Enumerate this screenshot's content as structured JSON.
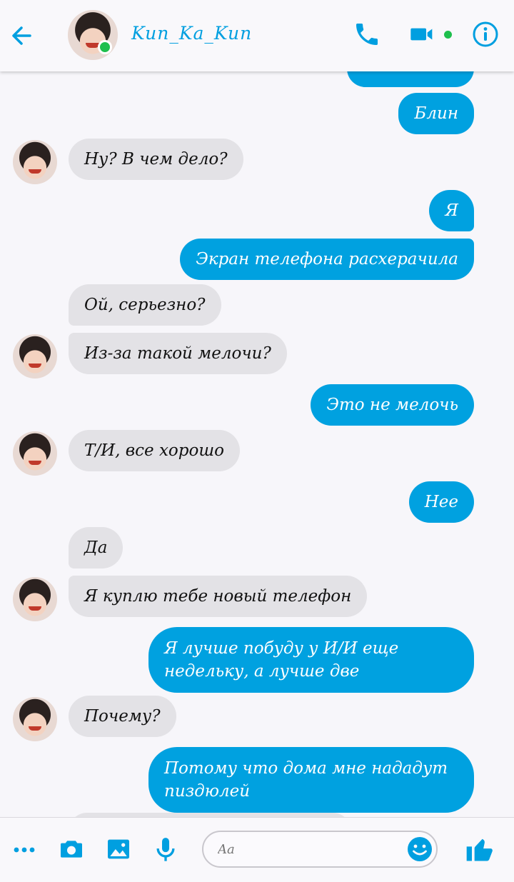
{
  "header": {
    "contact_name": "Kun_Ka_Kun",
    "back_icon": "arrow-left-icon",
    "call_icon": "phone-icon",
    "video_icon": "video-camera-icon",
    "info_icon": "info-icon"
  },
  "messages": [
    {
      "side": "out",
      "text": "Блин"
    },
    {
      "side": "in",
      "text": "Ну? В чем дело?"
    },
    {
      "side": "out",
      "text": "Я"
    },
    {
      "side": "out",
      "text": "Экран телефона расхерачила"
    },
    {
      "side": "in",
      "text": "Ой, серьезно?"
    },
    {
      "side": "in",
      "text": "Из-за такой мелочи?"
    },
    {
      "side": "out",
      "text": "Это не мелочь"
    },
    {
      "side": "in",
      "text": "Т/И, все хорошо"
    },
    {
      "side": "out",
      "text": "Нее"
    },
    {
      "side": "in",
      "text": "Да"
    },
    {
      "side": "in",
      "text": "Я куплю тебе новый телефон"
    },
    {
      "side": "out",
      "text": "Я лучше побуду у И/И еще\nнедельку, а лучше две"
    },
    {
      "side": "in",
      "text": "Почему?"
    },
    {
      "side": "out",
      "text": "Потому что дома мне нададут\nпиздюлей"
    }
  ],
  "composer": {
    "placeholder": "Aa",
    "more_icon": "more-dots-icon",
    "camera_icon": "camera-icon",
    "gallery_icon": "image-icon",
    "mic_icon": "microphone-icon",
    "emoji_icon": "smiley-icon",
    "like_icon": "thumbs-up-icon"
  },
  "colors": {
    "accent": "#00a1e0",
    "incoming_bubble": "#e3e2e6",
    "online": "#1fbf4d"
  }
}
